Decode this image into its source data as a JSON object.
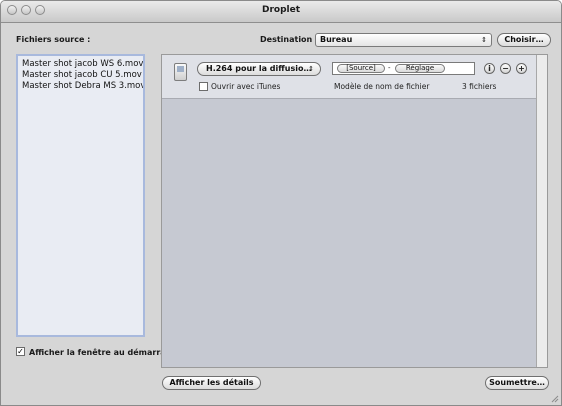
{
  "window": {
    "title": "Droplet"
  },
  "sources": {
    "label": "Fichiers source :",
    "files": [
      "Master shot jacob WS 6.mov",
      "Master shot jacob CU 5.mov",
      "Master shot Debra MS 3.mov"
    ]
  },
  "destination": {
    "label": "Destination :",
    "value": "Bureau",
    "choose_label": "Choisir…"
  },
  "setting": {
    "preset": "H.264 pour la diffusio…",
    "itunes_label": "Ouvrir avec iTunes",
    "itunes_checked": false,
    "tokens": [
      "[Source]",
      "-",
      "Réglage"
    ],
    "filename_label": "Modèle de nom de fichier",
    "file_count": "3 fichiers"
  },
  "options": {
    "show_at_launch_label": "Afficher la fenêtre au démarrage",
    "show_at_launch_checked": true
  },
  "footer": {
    "details_label": "Afficher les détails",
    "submit_label": "Soumettre…"
  },
  "icons": {
    "info": "info-icon",
    "remove": "remove-icon",
    "add": "add-icon",
    "device": "ipod-icon",
    "popup_arrows": "updown-arrows-icon",
    "resize": "resize-grip-icon"
  }
}
